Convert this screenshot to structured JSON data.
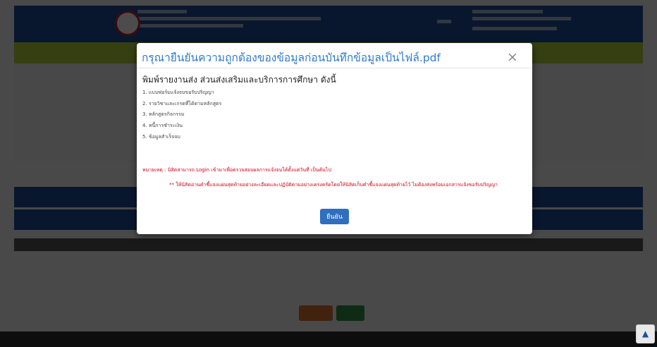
{
  "modal": {
    "title": "กรุณายืนยันความถูกต้องของข้อมูลก่อนบันทึกข้อมูลเป็นไฟล์.pdf",
    "close_glyph": "×",
    "heading": "พิมพ์รายงานส่ง ส่วนส่งเสริมและบริการการศึกษา ดังนี้",
    "items": [
      "1. แบบฟอร์มแจ้งจบขอรับปริญญา",
      "2. รายวิชาและเกรดที่ได้ตามหลักสูตร",
      "3. หลักสูตรกิจกรรม",
      "4. หนี้การชำระเงิน",
      "5. ข้อมูลสำเร็จจบ"
    ],
    "note1": "หมายเหตุ : นิสิตสามารถ Login เข้ามาเพื่อตรวจสอบผลการแจ้งจบได้ตั้งแต่วันที่ เป็นต้นไป",
    "note2": "** ให้นิสิตอ่านคำชี้แจงแผ่นสุดท้ายอย่างละเอียดและปฏิบัติตามอย่างเคร่งครัดโดยให้นิสิตเก็บคำชี้แจงแผ่นสุดท้ายไว้ ไม่ต้องส่งพร้อมเอกสารแจ้งขอรับปริญญา",
    "confirm_label": "ยืนยัน"
  },
  "scroll_top_glyph": "▲"
}
